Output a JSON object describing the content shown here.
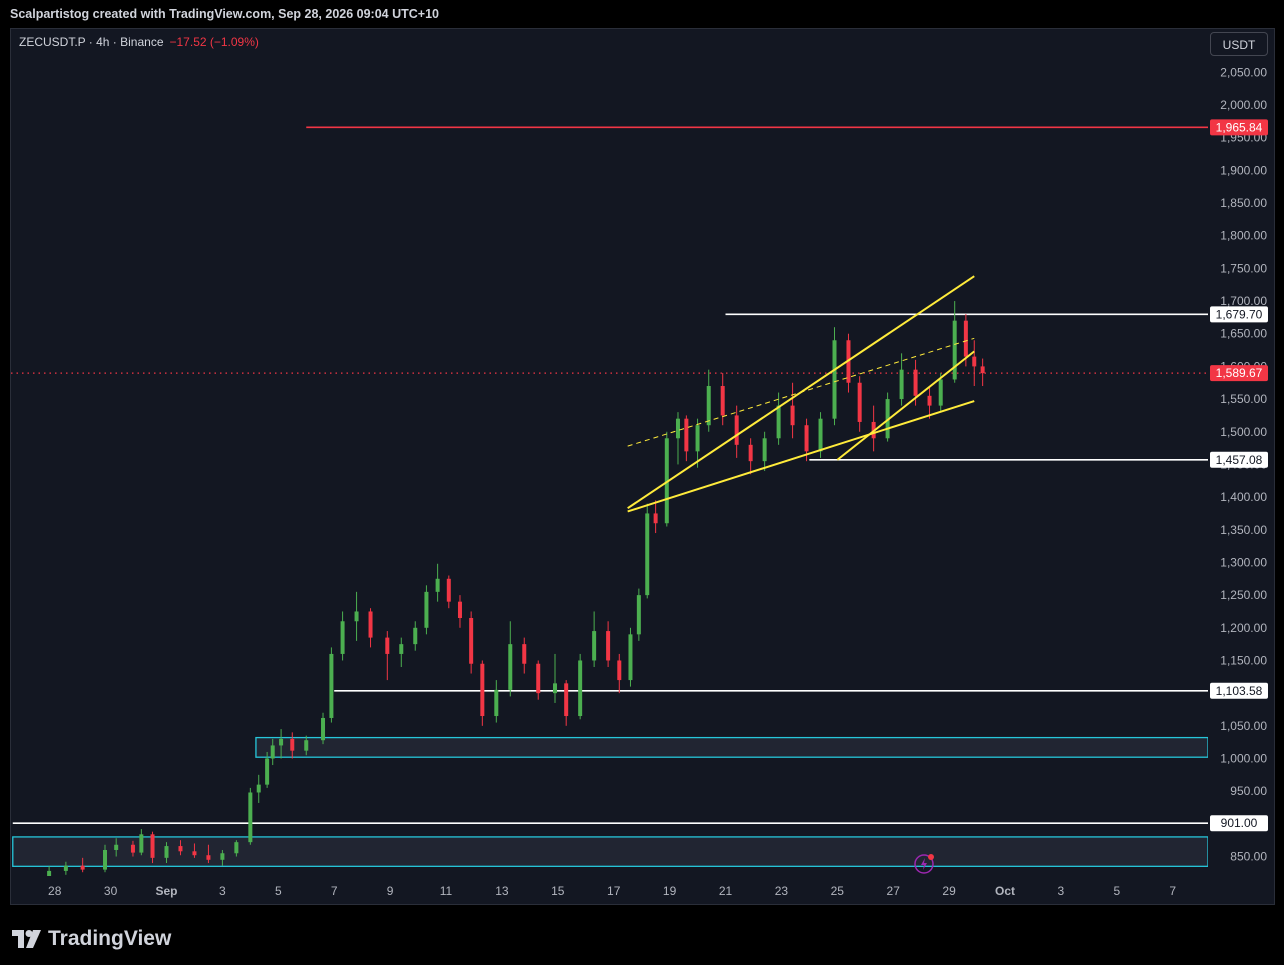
{
  "header": {
    "attribution": "Scalpartistog created with TradingView.com, Sep 28, 2026 09:04 UTC+10"
  },
  "legend": {
    "symbol": "ZECUSDT.P · 4h · Binance",
    "change": "−17.52 (−1.09%)"
  },
  "currency_button": "USDT",
  "footer": {
    "brand": "TradingView"
  },
  "colors": {
    "background": "#131722",
    "up": "#26a69a",
    "down": "#f23645",
    "up_candle": "#4caf50",
    "resistance": "#f23645",
    "channel": "#ffeb3b",
    "zone": "#26c6da",
    "level": "#ffffff"
  },
  "chart_data": {
    "type": "candlestick",
    "title": "",
    "xlabel": "",
    "ylabel": "",
    "ylim": [
      835,
      2080
    ],
    "y_ticks": [
      850,
      900,
      950,
      1000,
      1050,
      1100,
      1150,
      1200,
      1250,
      1300,
      1350,
      1400,
      1450,
      1500,
      1550,
      1600,
      1650,
      1700,
      1750,
      1800,
      1850,
      1900,
      1950,
      2000,
      2050
    ],
    "y_tick_labels": [
      "850.00",
      "900.00",
      "950.00",
      "1,000.00",
      "1,050.00",
      "1,100.00",
      "1,150.00",
      "1,200.00",
      "1,250.00",
      "1,300.00",
      "1,350.00",
      "1,400.00",
      "1,450.00",
      "1,500.00",
      "1,550.00",
      "1,600.00",
      "1,650.00",
      "1,700.00",
      "1,750.00",
      "1,800.00",
      "1,850.00",
      "1,900.00",
      "1,950.00",
      "2,000.00",
      "2,050.00"
    ],
    "x_ticks": [
      "28",
      "30",
      "Sep",
      "3",
      "5",
      "7",
      "9",
      "11",
      "13",
      "15",
      "17",
      "19",
      "21",
      "23",
      "25",
      "27",
      "29",
      "Oct",
      "3",
      "5",
      "7"
    ],
    "x_tick_days": [
      -4,
      -2,
      0,
      2,
      4,
      6,
      8,
      10,
      12,
      14,
      16,
      18,
      20,
      22,
      24,
      26,
      28,
      30,
      32,
      34,
      36
    ],
    "current_price": {
      "value": 1589.67,
      "label": "1,589.67"
    },
    "horizontal_levels": [
      {
        "value": 1965.84,
        "label": "1,965.84",
        "color": "#f23645",
        "from_day": 5
      },
      {
        "value": 1679.7,
        "label": "1,679.70",
        "color": "#ffffff",
        "from_day": 20
      },
      {
        "value": 1457.08,
        "label": "1,457.08",
        "color": "#ffffff",
        "from_day": 23
      },
      {
        "value": 1103.58,
        "label": "1,103.58",
        "color": "#ffffff",
        "from_day": 6
      },
      {
        "value": 901.0,
        "label": "901.00",
        "color": "#ffffff",
        "from_day": -5.5
      }
    ],
    "zones": [
      {
        "from_day": 3.2,
        "top": 1032,
        "bottom": 1002,
        "color": "#26c6da"
      },
      {
        "from_day": -5.5,
        "top": 880,
        "bottom": 835,
        "color": "#26c6da"
      }
    ],
    "trendlines": [
      {
        "start": [
          16.5,
          1383
        ],
        "end": [
          28.9,
          1738
        ],
        "style": "solid",
        "color": "#ffeb3b"
      },
      {
        "start": [
          16.5,
          1378
        ],
        "end": [
          28.9,
          1547
        ],
        "style": "solid",
        "color": "#ffeb3b"
      },
      {
        "start": [
          16.5,
          1478
        ],
        "end": [
          28.9,
          1643
        ],
        "style": "dashed",
        "color": "#ffeb3b"
      },
      {
        "start": [
          24.0,
          1457
        ],
        "end": [
          28.9,
          1623
        ],
        "style": "solid",
        "color": "#ffeb3b"
      }
    ],
    "candles_4h": [
      [
        -4.2,
        820,
        835,
        810,
        828
      ],
      [
        -3.6,
        828,
        842,
        822,
        836
      ],
      [
        -3.0,
        836,
        848,
        826,
        830
      ],
      [
        -2.2,
        830,
        868,
        826,
        860
      ],
      [
        -1.8,
        860,
        878,
        850,
        868
      ],
      [
        -1.2,
        868,
        874,
        850,
        856
      ],
      [
        -0.9,
        856,
        892,
        852,
        884
      ],
      [
        -0.5,
        884,
        888,
        840,
        848
      ],
      [
        0.0,
        848,
        872,
        840,
        866
      ],
      [
        0.5,
        866,
        875,
        852,
        858
      ],
      [
        1.0,
        858,
        870,
        848,
        852
      ],
      [
        1.5,
        852,
        868,
        840,
        845
      ],
      [
        2.0,
        845,
        860,
        836,
        855
      ],
      [
        2.5,
        855,
        875,
        850,
        872
      ],
      [
        3.0,
        872,
        955,
        868,
        948
      ],
      [
        3.3,
        948,
        975,
        932,
        960
      ],
      [
        3.6,
        960,
        1010,
        955,
        1000
      ],
      [
        3.8,
        1000,
        1030,
        990,
        1020
      ],
      [
        4.1,
        1020,
        1045,
        1000,
        1030
      ],
      [
        4.5,
        1030,
        1040,
        1000,
        1012
      ],
      [
        5.0,
        1012,
        1035,
        1005,
        1028
      ],
      [
        5.6,
        1028,
        1070,
        1022,
        1062
      ],
      [
        5.9,
        1062,
        1170,
        1055,
        1160
      ],
      [
        6.3,
        1160,
        1225,
        1150,
        1210
      ],
      [
        6.8,
        1210,
        1255,
        1180,
        1225
      ],
      [
        7.3,
        1225,
        1230,
        1170,
        1185
      ],
      [
        7.9,
        1185,
        1195,
        1120,
        1160
      ],
      [
        8.4,
        1160,
        1185,
        1140,
        1175
      ],
      [
        8.9,
        1175,
        1210,
        1165,
        1200
      ],
      [
        9.3,
        1200,
        1265,
        1190,
        1255
      ],
      [
        9.7,
        1255,
        1298,
        1240,
        1275
      ],
      [
        10.1,
        1275,
        1280,
        1230,
        1240
      ],
      [
        10.5,
        1240,
        1250,
        1200,
        1215
      ],
      [
        10.9,
        1215,
        1225,
        1130,
        1145
      ],
      [
        11.3,
        1145,
        1150,
        1050,
        1065
      ],
      [
        11.8,
        1065,
        1120,
        1055,
        1105
      ],
      [
        12.3,
        1105,
        1210,
        1095,
        1175
      ],
      [
        12.8,
        1175,
        1185,
        1130,
        1145
      ],
      [
        13.3,
        1145,
        1150,
        1090,
        1100
      ],
      [
        13.9,
        1100,
        1160,
        1085,
        1115
      ],
      [
        14.3,
        1115,
        1120,
        1050,
        1065
      ],
      [
        14.8,
        1065,
        1160,
        1060,
        1150
      ],
      [
        15.3,
        1150,
        1225,
        1140,
        1195
      ],
      [
        15.8,
        1195,
        1210,
        1140,
        1150
      ],
      [
        16.2,
        1150,
        1160,
        1100,
        1120
      ],
      [
        16.6,
        1120,
        1200,
        1110,
        1190
      ],
      [
        16.9,
        1190,
        1260,
        1180,
        1250
      ],
      [
        17.2,
        1250,
        1390,
        1245,
        1375
      ],
      [
        17.5,
        1375,
        1395,
        1345,
        1360
      ],
      [
        17.9,
        1360,
        1500,
        1355,
        1490
      ],
      [
        18.3,
        1490,
        1530,
        1450,
        1520
      ],
      [
        18.6,
        1520,
        1525,
        1455,
        1470
      ],
      [
        19.0,
        1470,
        1520,
        1445,
        1510
      ],
      [
        19.4,
        1510,
        1595,
        1500,
        1570
      ],
      [
        19.9,
        1570,
        1590,
        1510,
        1525
      ],
      [
        20.4,
        1525,
        1540,
        1460,
        1480
      ],
      [
        20.9,
        1480,
        1490,
        1435,
        1455
      ],
      [
        21.4,
        1455,
        1500,
        1440,
        1490
      ],
      [
        21.9,
        1490,
        1560,
        1480,
        1540
      ],
      [
        22.4,
        1540,
        1575,
        1490,
        1510
      ],
      [
        22.9,
        1510,
        1520,
        1455,
        1470
      ],
      [
        23.4,
        1470,
        1530,
        1460,
        1520
      ],
      [
        23.9,
        1520,
        1660,
        1510,
        1640
      ],
      [
        24.4,
        1640,
        1650,
        1560,
        1575
      ],
      [
        24.8,
        1575,
        1585,
        1500,
        1515
      ],
      [
        25.3,
        1515,
        1540,
        1470,
        1490
      ],
      [
        25.8,
        1490,
        1560,
        1485,
        1550
      ],
      [
        26.3,
        1550,
        1620,
        1540,
        1595
      ],
      [
        26.8,
        1595,
        1610,
        1540,
        1555
      ],
      [
        27.3,
        1555,
        1570,
        1520,
        1540
      ],
      [
        27.7,
        1540,
        1590,
        1530,
        1580
      ],
      [
        28.2,
        1580,
        1700,
        1575,
        1670
      ],
      [
        28.6,
        1670,
        1680,
        1600,
        1615
      ],
      [
        28.9,
        1615,
        1640,
        1570,
        1600
      ],
      [
        29.2,
        1600,
        1612,
        1570,
        1589.67
      ]
    ]
  }
}
